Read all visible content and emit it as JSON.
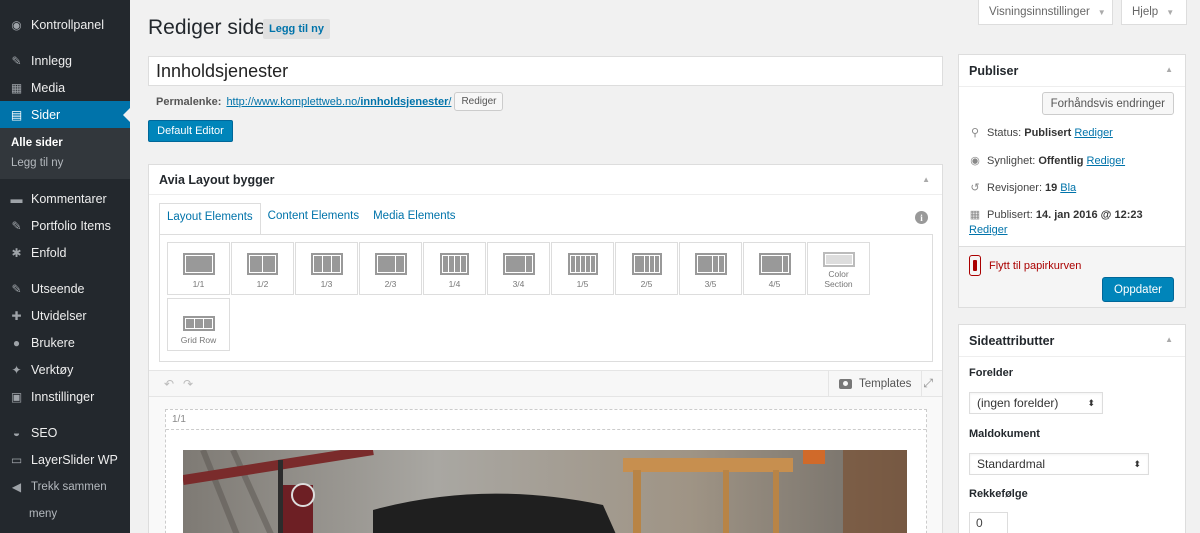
{
  "sidebar": {
    "items": [
      {
        "label": "Kontrollpanel",
        "icon": "dashboard-icon",
        "glyph": "◉"
      },
      {
        "label": "Innlegg",
        "icon": "pin-icon",
        "glyph": "✎"
      },
      {
        "label": "Media",
        "icon": "media-icon",
        "glyph": "▦"
      },
      {
        "label": "Sider",
        "icon": "pages-icon",
        "glyph": "▤"
      },
      {
        "label": "Kommentarer",
        "icon": "comment-icon",
        "glyph": "▬"
      },
      {
        "label": "Portfolio Items",
        "icon": "pin-icon",
        "glyph": "✎"
      },
      {
        "label": "Enfold",
        "icon": "gear-icon",
        "glyph": "✱"
      },
      {
        "label": "Utseende",
        "icon": "brush-icon",
        "glyph": "✎"
      },
      {
        "label": "Utvidelser",
        "icon": "plugin-icon",
        "glyph": "✚"
      },
      {
        "label": "Brukere",
        "icon": "user-icon",
        "glyph": "●"
      },
      {
        "label": "Verktøy",
        "icon": "wrench-icon",
        "glyph": "✦"
      },
      {
        "label": "Innstillinger",
        "icon": "settings-icon",
        "glyph": "▣"
      },
      {
        "label": "SEO",
        "icon": "seo-icon",
        "glyph": "◒"
      },
      {
        "label": "LayerSlider WP",
        "icon": "layers-icon",
        "glyph": "▭"
      },
      {
        "label": "Trekk sammen",
        "icon": "collapse-icon",
        "glyph": "◀"
      },
      {
        "label": "meny"
      }
    ],
    "submenu": [
      "Alle sider",
      "Legg til ny"
    ]
  },
  "screen_options": {
    "label": "Visningsinnstillinger",
    "help": "Hjelp"
  },
  "header": {
    "title": "Rediger side",
    "add_new": "Legg til ny"
  },
  "editor": {
    "title_value": "Innholdsjenester",
    "permalink_label": "Permalenke:",
    "permalink_base": "http://www.komplettweb.no/",
    "permalink_slug": "innholdsjenester",
    "permalink_suffix": "/",
    "permalink_edit": "Rediger",
    "default_editor": "Default Editor"
  },
  "builder": {
    "title": "Avia Layout bygger",
    "tabs": [
      "Layout Elements",
      "Content Elements",
      "Media Elements"
    ],
    "elements": [
      {
        "label": "1/1"
      },
      {
        "label": "1/2"
      },
      {
        "label": "1/3"
      },
      {
        "label": "2/3"
      },
      {
        "label": "1/4"
      },
      {
        "label": "3/4"
      },
      {
        "label": "1/5"
      },
      {
        "label": "2/5"
      },
      {
        "label": "3/5"
      },
      {
        "label": "4/5"
      },
      {
        "label": "Color Section"
      },
      {
        "label": "Grid Row"
      }
    ],
    "templates": "Templates",
    "row_label": "1/1"
  },
  "publish": {
    "title": "Publiser",
    "preview": "Forhåndsvis endringer",
    "status_label": "Status:",
    "status_value": "Publisert",
    "status_edit": "Rediger",
    "visibility_label": "Synlighet:",
    "visibility_value": "Offentlig",
    "visibility_edit": "Rediger",
    "revisions_label": "Revisjoner:",
    "revisions_value": "19",
    "revisions_link": "Bla",
    "published_label": "Publisert:",
    "published_value": "14. jan 2016 @ 12:23",
    "published_edit": "Rediger",
    "trash": "Flytt til papirkurven",
    "update": "Oppdater"
  },
  "page_attributes": {
    "title": "Sideattributter",
    "parent_label": "Forelder",
    "parent_value": "(ingen forelder)",
    "template_label": "Maldokument",
    "template_value": "Standardmal",
    "order_label": "Rekkefølge",
    "order_value": "0"
  },
  "colors": {
    "sidebar_bg": "#23282d",
    "accent": "#0073aa",
    "primary_button": "#0085ba",
    "trash": "#a00000"
  }
}
